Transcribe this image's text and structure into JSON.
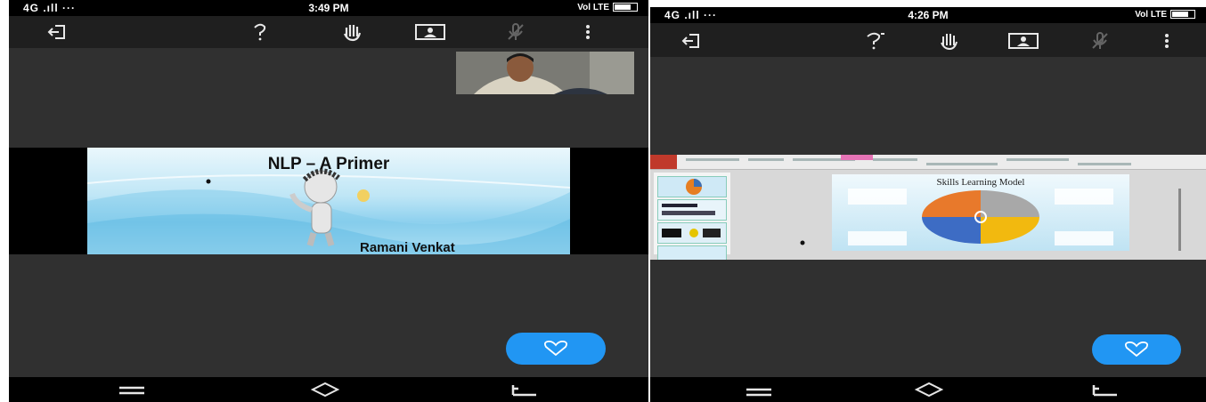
{
  "left_phone": {
    "status": {
      "signal": "4G .ıll ···",
      "time": "3:49 PM",
      "right": "Vol LTE"
    },
    "slide": {
      "title": "NLP – A Primer",
      "author": "Ramani Venkat"
    }
  },
  "right_phone": {
    "status": {
      "signal": "4G .ıll ···",
      "time": "4:26 PM",
      "right": "Vol LTE"
    },
    "slide": {
      "title": "Skills Learning Model"
    }
  },
  "icons": {
    "exit": "exit-icon",
    "question": "question-icon",
    "raise_hand": "raise-hand-icon",
    "presentation": "presentation-icon",
    "microphone": "microphone-icon",
    "more": "more-icon",
    "heart": "heart-icon",
    "menu": "menu-icon",
    "home": "home-icon",
    "back": "back-icon"
  },
  "colors": {
    "accent": "#2196f3",
    "toolbar": "#1f1f1f",
    "background": "#303030"
  }
}
